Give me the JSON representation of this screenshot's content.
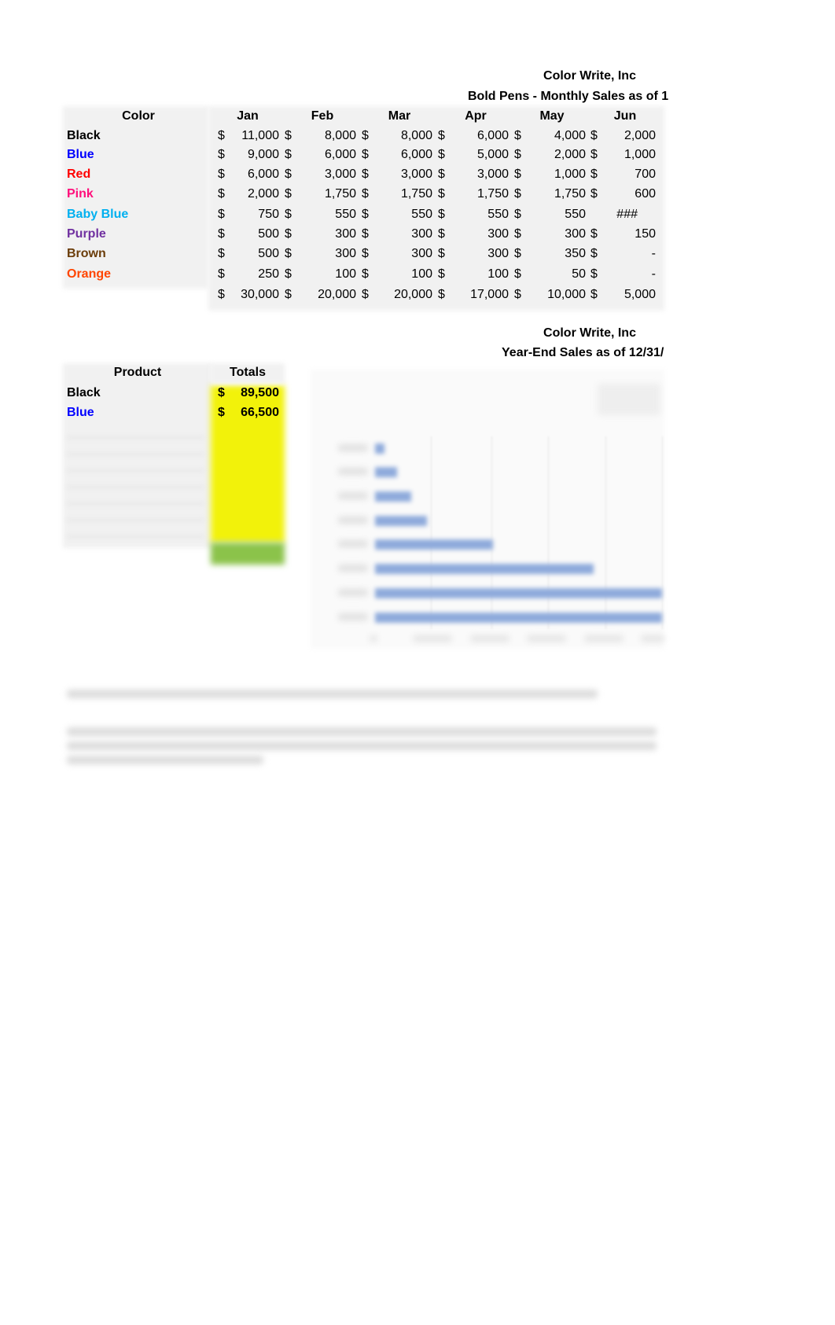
{
  "sheet1": {
    "company": "Color Write, Inc",
    "subtitle": "Bold Pens - Monthly Sales as of 1",
    "headers": [
      "Color",
      "Jan",
      "Feb",
      "Mar",
      "Apr",
      "May",
      "Jun"
    ],
    "rows": [
      {
        "label": "Black",
        "color": "#000000",
        "cells": [
          [
            "$",
            "11,000"
          ],
          [
            "$",
            "8,000"
          ],
          [
            "$",
            "8,000"
          ],
          [
            "$",
            "6,000"
          ],
          [
            "$",
            "4,000"
          ],
          [
            "$",
            "2,000"
          ]
        ]
      },
      {
        "label": "Blue",
        "color": "#0000ff",
        "cells": [
          [
            "$",
            "9,000"
          ],
          [
            "$",
            "6,000"
          ],
          [
            "$",
            "6,000"
          ],
          [
            "$",
            "5,000"
          ],
          [
            "$",
            "2,000"
          ],
          [
            "$",
            "1,000"
          ]
        ]
      },
      {
        "label": "Red",
        "color": "#ff0000",
        "cells": [
          [
            "$",
            "6,000"
          ],
          [
            "$",
            "3,000"
          ],
          [
            "$",
            "3,000"
          ],
          [
            "$",
            "3,000"
          ],
          [
            "$",
            "1,000"
          ],
          [
            "$",
            "700"
          ]
        ]
      },
      {
        "label": "Pink",
        "color": "#ff0f7b",
        "cells": [
          [
            "$",
            "2,000"
          ],
          [
            "$",
            "1,750"
          ],
          [
            "$",
            "1,750"
          ],
          [
            "$",
            "1,750"
          ],
          [
            "$",
            "1,750"
          ],
          [
            "$",
            "600"
          ]
        ]
      },
      {
        "label": "Baby Blue",
        "color": "#00b0f0",
        "cells": [
          [
            "$",
            "750"
          ],
          [
            "$",
            "550"
          ],
          [
            "$",
            "550"
          ],
          [
            "$",
            "550"
          ],
          [
            "$",
            "550"
          ],
          [
            "",
            "###"
          ]
        ]
      },
      {
        "label": "Purple",
        "color": "#7030a0",
        "cells": [
          [
            "$",
            "500"
          ],
          [
            "$",
            "300"
          ],
          [
            "$",
            "300"
          ],
          [
            "$",
            "300"
          ],
          [
            "$",
            "300"
          ],
          [
            "$",
            "150"
          ]
        ]
      },
      {
        "label": "Brown",
        "color": "#6b3d0a",
        "cells": [
          [
            "$",
            "500"
          ],
          [
            "$",
            "300"
          ],
          [
            "$",
            "300"
          ],
          [
            "$",
            "300"
          ],
          [
            "$",
            "350"
          ],
          [
            "$",
            "-"
          ]
        ]
      },
      {
        "label": "Orange",
        "color": "#ff4500",
        "cells": [
          [
            "$",
            "250"
          ],
          [
            "$",
            "100"
          ],
          [
            "$",
            "100"
          ],
          [
            "$",
            "100"
          ],
          [
            "$",
            "50"
          ],
          [
            "$",
            "-"
          ]
        ]
      },
      {
        "label": "",
        "color": "#000000",
        "cells": [
          [
            "$",
            "30,000"
          ],
          [
            "$",
            "20,000"
          ],
          [
            "$",
            "20,000"
          ],
          [
            "$",
            "17,000"
          ],
          [
            "$",
            "10,000"
          ],
          [
            "$",
            "5,000"
          ]
        ]
      }
    ]
  },
  "sheet2": {
    "company": "Color Write, Inc",
    "subtitle": "Year-End Sales as of 12/31/",
    "headers": [
      "Product",
      "Totals"
    ],
    "rows": [
      {
        "label": "Black",
        "color": "#000000",
        "currency": "$",
        "total": "89,500"
      },
      {
        "label": "Blue",
        "color": "#0000ff",
        "currency": "$",
        "total": "66,500"
      }
    ],
    "highlight_color": "#f2f20a",
    "total_cell_color": "#8bc34a",
    "chart_bar_color": "#8eaadb"
  }
}
